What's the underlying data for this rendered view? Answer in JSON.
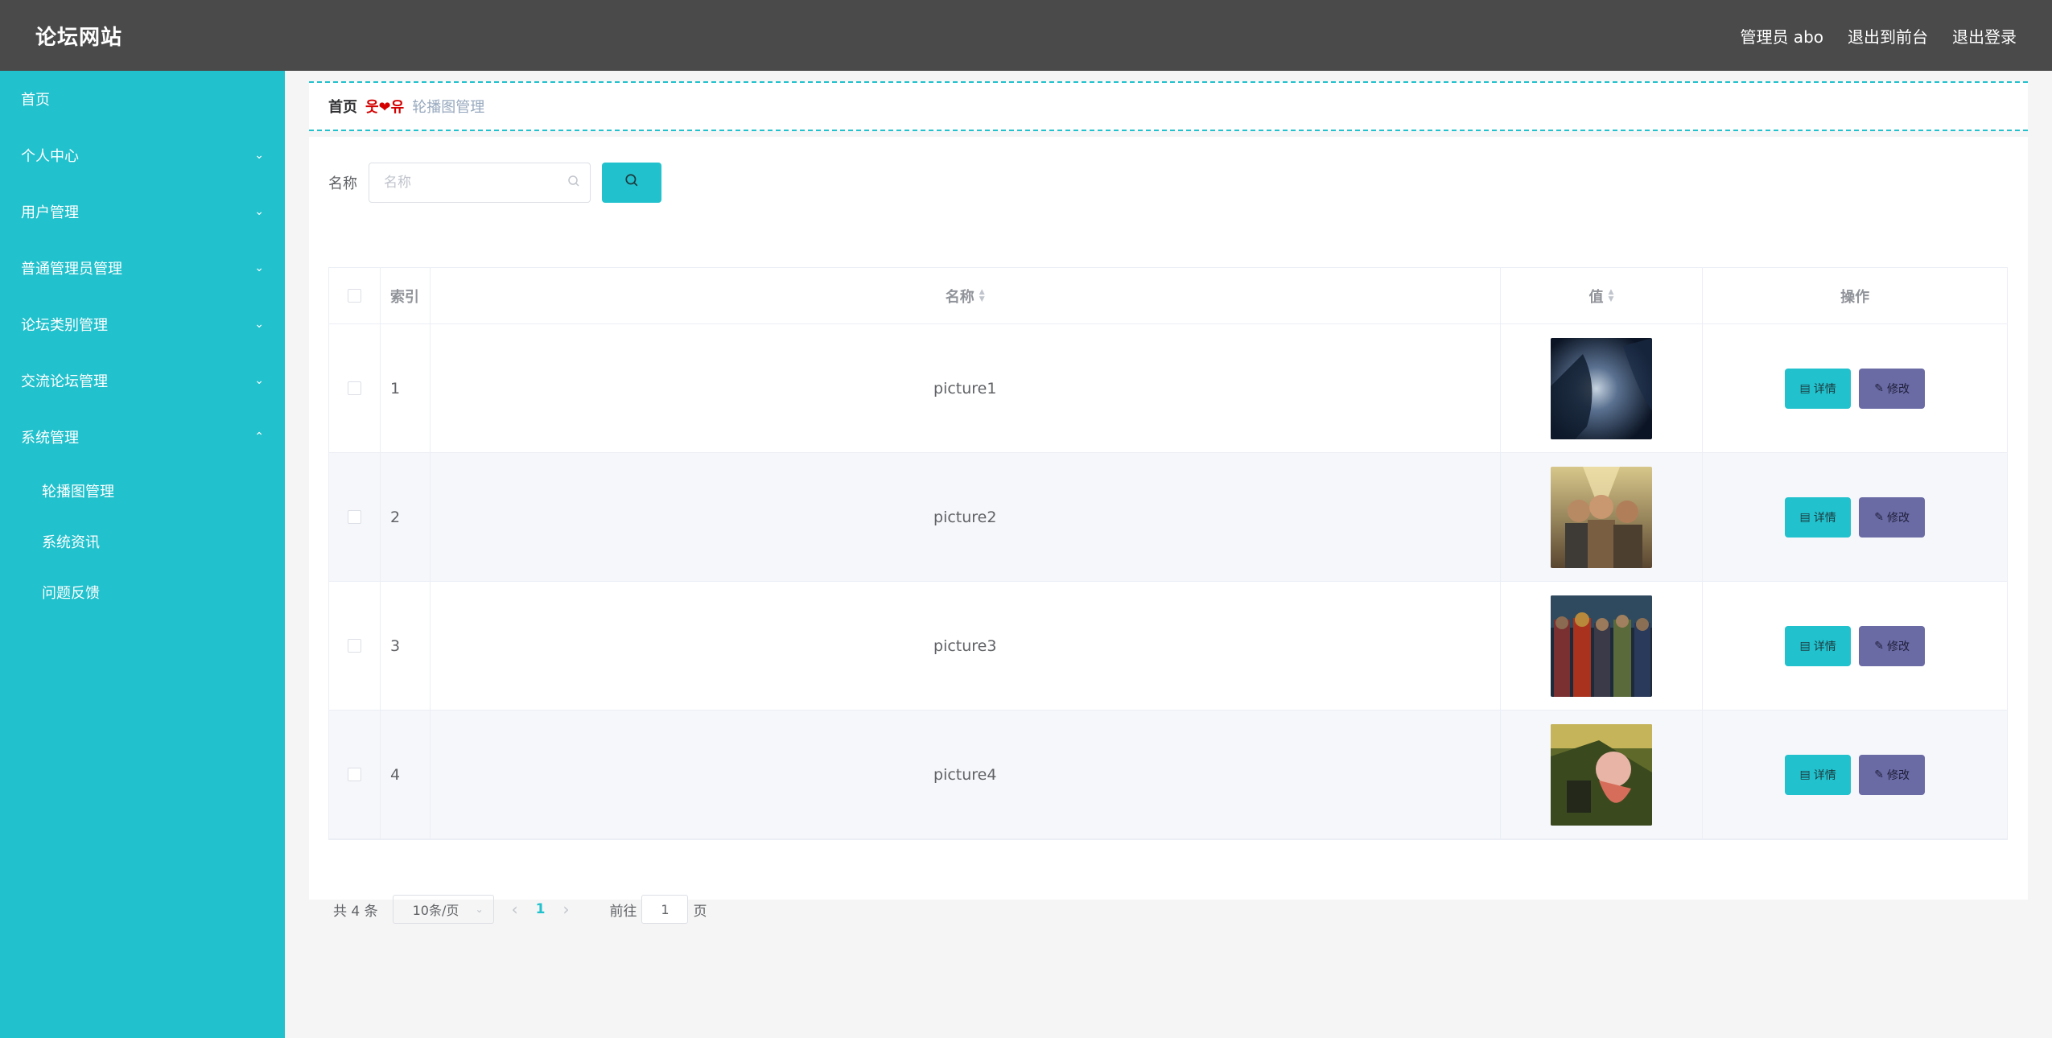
{
  "header": {
    "brand": "论坛网站",
    "admin_label": "管理员 abo",
    "exit_front": "退出到前台",
    "logout": "退出登录"
  },
  "sidebar": {
    "items": [
      {
        "label": "首页",
        "has_chevron": false
      },
      {
        "label": "个人中心",
        "has_chevron": true,
        "chevron": "⌄"
      },
      {
        "label": "用户管理",
        "has_chevron": true,
        "chevron": "⌄"
      },
      {
        "label": "普通管理员管理",
        "has_chevron": true,
        "chevron": "⌄"
      },
      {
        "label": "论坛类别管理",
        "has_chevron": true,
        "chevron": "⌄"
      },
      {
        "label": "交流论坛管理",
        "has_chevron": true,
        "chevron": "⌄"
      },
      {
        "label": "系统管理",
        "has_chevron": true,
        "chevron": "⌃"
      }
    ],
    "subitems": [
      {
        "label": "轮播图管理"
      },
      {
        "label": "系统资讯"
      },
      {
        "label": "问题反馈"
      }
    ]
  },
  "breadcrumb": {
    "home": "首页",
    "separator": "웃❤유",
    "current": "轮播图管理"
  },
  "search": {
    "label": "名称",
    "placeholder": "名称",
    "value": ""
  },
  "table": {
    "headers": {
      "index": "索引",
      "name": "名称",
      "value": "值",
      "ops": "操作"
    },
    "rows": [
      {
        "index": "1",
        "name": "picture1"
      },
      {
        "index": "2",
        "name": "picture2"
      },
      {
        "index": "3",
        "name": "picture3"
      },
      {
        "index": "4",
        "name": "picture4"
      }
    ],
    "detail_label": "详情",
    "edit_label": "修改"
  },
  "pagination": {
    "total": "共 4 条",
    "page_size": "10条/页",
    "current_page": "1",
    "goto_prefix": "前往",
    "goto_value": "1",
    "goto_suffix": "页"
  },
  "colors": {
    "accent": "#21c1cd",
    "topbar": "#4a4a4a",
    "edit_button": "#6a6aa5"
  }
}
